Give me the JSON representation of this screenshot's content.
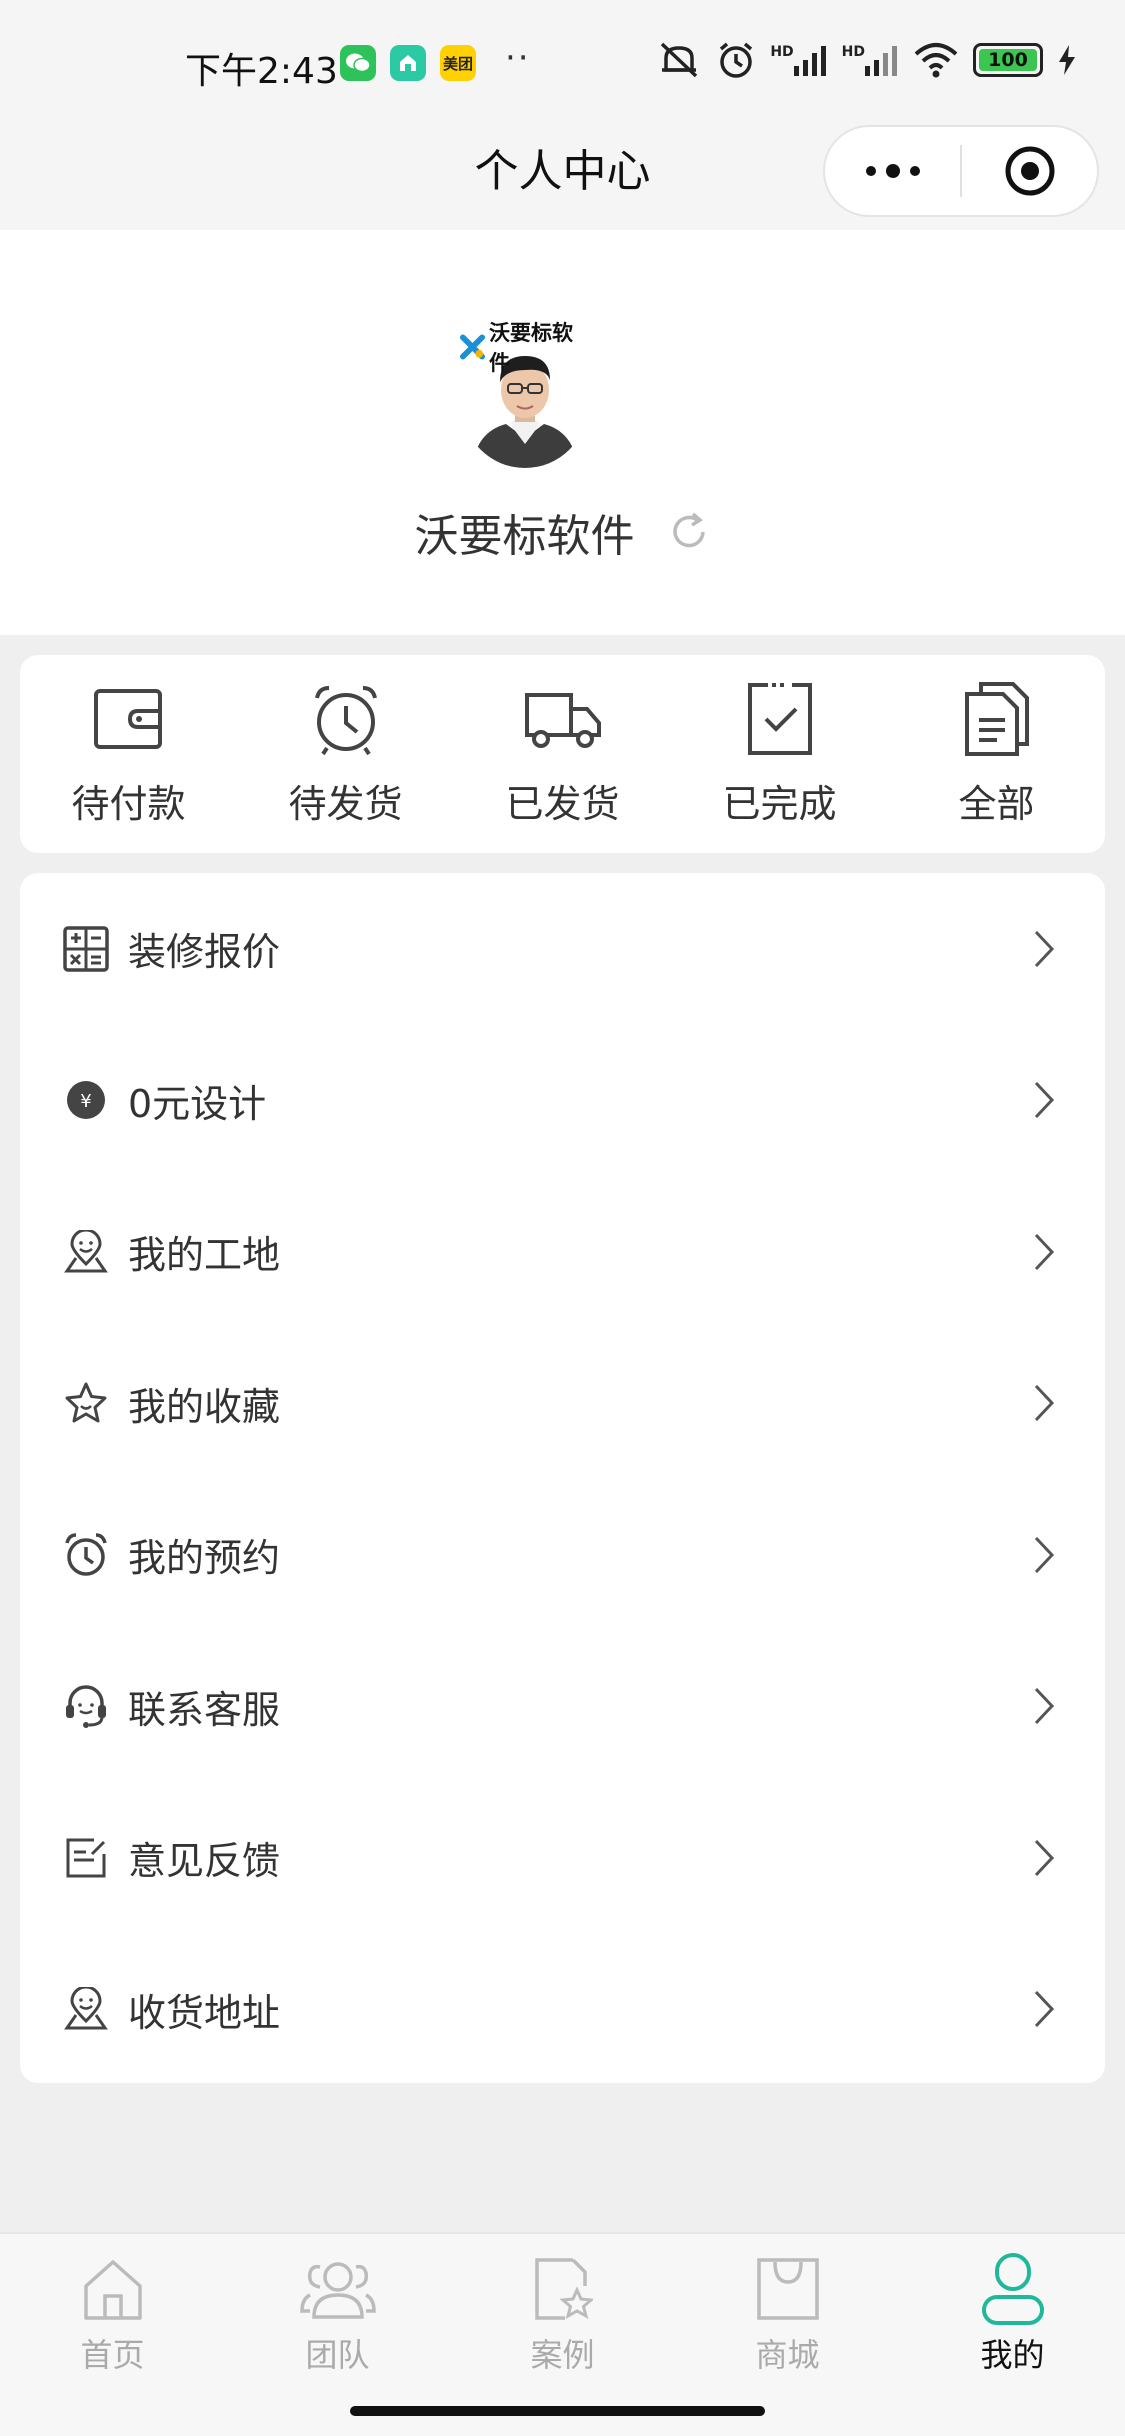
{
  "status_bar": {
    "time": "下午2:43",
    "apps": [
      "wechat-app-icon",
      "house-app-icon",
      "meituan-app-icon"
    ],
    "meituan_label": "美团",
    "more": "··",
    "hd1": "HD",
    "hd2": "HD",
    "battery": "100"
  },
  "header": {
    "title": "个人中心"
  },
  "profile": {
    "brand": "沃要标软件",
    "username": "沃要标软件"
  },
  "orders": [
    {
      "label": "待付款",
      "icon": "wallet-icon"
    },
    {
      "label": "待发货",
      "icon": "alarm-clock-icon"
    },
    {
      "label": "已发货",
      "icon": "truck-icon"
    },
    {
      "label": "已完成",
      "icon": "clipboard-check-icon"
    },
    {
      "label": "全部",
      "icon": "documents-icon"
    }
  ],
  "menu": [
    {
      "label": "装修报价",
      "icon": "calculator-icon"
    },
    {
      "label": "0元设计",
      "icon": "yuan-coin-icon"
    },
    {
      "label": "我的工地",
      "icon": "location-pin-icon"
    },
    {
      "label": "我的收藏",
      "icon": "star-icon"
    },
    {
      "label": "我的预约",
      "icon": "alarm-clock-icon"
    },
    {
      "label": "联系客服",
      "icon": "headset-icon"
    },
    {
      "label": "意见反馈",
      "icon": "feedback-edit-icon"
    },
    {
      "label": "收货地址",
      "icon": "location-pin-icon"
    }
  ],
  "tabbar": [
    {
      "label": "首页",
      "icon": "home-icon",
      "active": false
    },
    {
      "label": "团队",
      "icon": "team-icon",
      "active": false
    },
    {
      "label": "案例",
      "icon": "case-file-icon",
      "active": false
    },
    {
      "label": "商城",
      "icon": "shopping-bag-icon",
      "active": false
    },
    {
      "label": "我的",
      "icon": "profile-icon",
      "active": true
    }
  ],
  "colors": {
    "accent": "#1fb89a",
    "wechat": "#2dc35a",
    "battery": "#3cc651",
    "meituan": "#ffd100"
  }
}
